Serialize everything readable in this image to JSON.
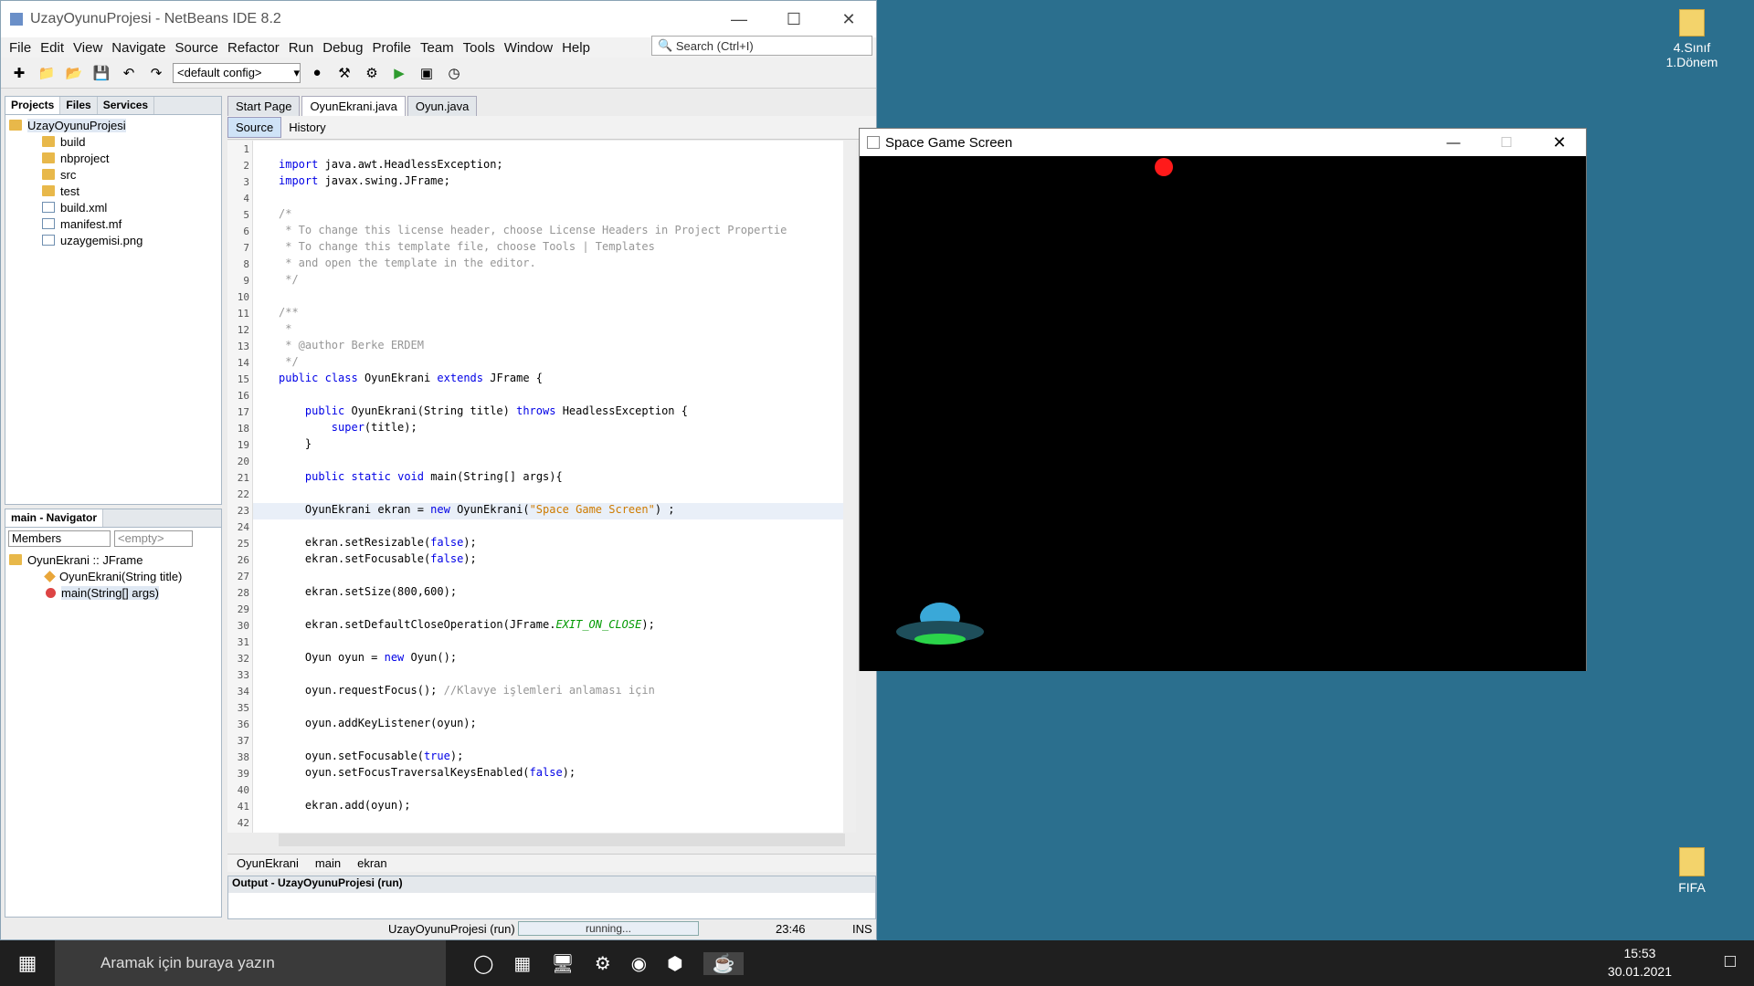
{
  "ide": {
    "title": "UzayOyunuProjesi - NetBeans IDE 8.2",
    "menu": [
      "File",
      "Edit",
      "View",
      "Navigate",
      "Source",
      "Refactor",
      "Run",
      "Debug",
      "Profile",
      "Team",
      "Tools",
      "Window",
      "Help"
    ],
    "search_placeholder": "Search (Ctrl+I)",
    "config": "<default config>",
    "project_tabs": [
      "Projects",
      "Files",
      "Services"
    ],
    "tree": [
      "UzayOyunuProjesi",
      "build",
      "nbproject",
      "src",
      "test",
      "build.xml",
      "manifest.mf",
      "uzaygemisi.png"
    ],
    "navigator_title": "main - Navigator",
    "navigator_filter": "Members",
    "navigator_empty": "<empty>",
    "navigator_items": [
      "OyunEkrani :: JFrame",
      "OyunEkrani(String title)",
      "main(String[] args)"
    ],
    "editor_tabs": [
      "Start Page",
      "OyunEkrani.java",
      "Oyun.java"
    ],
    "editor_subtabs": [
      "Source",
      "History"
    ],
    "breadcrumb": [
      "OyunEkrani",
      "main",
      "ekran"
    ],
    "output_title": "Output - UzayOyunuProjesi (run)",
    "status_project": "UzayOyunuProjesi (run)",
    "status_running": "running...",
    "status_pos": "23:46",
    "status_mode": "INS"
  },
  "code_lines": [
    "",
    "import java.awt.HeadlessException;",
    "import javax.swing.JFrame;",
    "",
    "/*",
    " * To change this license header, choose License Headers in Project Propertie",
    " * To change this template file, choose Tools | Templates",
    " * and open the template in the editor.",
    " */",
    "",
    "/**",
    " *",
    " * @author Berke ERDEM",
    " */",
    "public class OyunEkrani extends JFrame {",
    "",
    "    public OyunEkrani(String title) throws HeadlessException {",
    "        super(title);",
    "    }",
    "",
    "    public static void main(String[] args){",
    "",
    "    OyunEkrani ekran = new OyunEkrani(\"Space Game Screen\") ;",
    "",
    "    ekran.setResizable(false);",
    "    ekran.setFocusable(false);",
    "",
    "    ekran.setSize(800,600);",
    "",
    "    ekran.setDefaultCloseOperation(JFrame.EXIT_ON_CLOSE);",
    "",
    "    Oyun oyun = new Oyun();",
    "",
    "    oyun.requestFocus(); //Klavye işlemleri anlaması için",
    "",
    "    oyun.addKeyListener(oyun);",
    "",
    "    oyun.setFocusable(true);",
    "    oyun.setFocusTraversalKeysEnabled(false);",
    "",
    "    ekran.add(oyun);",
    ""
  ],
  "game": {
    "title": "Space Game Screen"
  },
  "desktop": {
    "icon1": "4.Sınıf 1.Dönem",
    "icon2": "FIFA"
  },
  "taskbar": {
    "search": "Aramak için buraya yazın",
    "time": "15:53",
    "date": "30.01.2021"
  }
}
